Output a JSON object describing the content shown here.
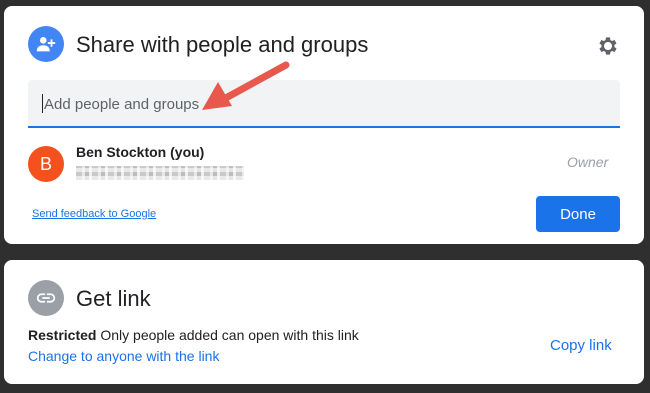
{
  "share": {
    "title": "Share with people and groups",
    "add_placeholder": "Add people and groups",
    "user": {
      "initial": "B",
      "name": "Ben Stockton (you)",
      "email": "████████████████",
      "role": "Owner"
    },
    "feedback_label": "Send feedback to Google",
    "done_label": "Done"
  },
  "link": {
    "title": "Get link",
    "restricted_label": "Restricted",
    "restricted_desc": "Only people added can open with this link",
    "change_label": "Change to anyone with the link",
    "copy_label": "Copy link"
  },
  "colors": {
    "accent": "#1a73e8",
    "share_icon_bg": "#4285f4",
    "user_avatar_bg": "#f4511e",
    "link_icon_bg": "#9aa0a6",
    "annotation_arrow": "#e8584c",
    "backdrop": "#2f2f2f"
  },
  "icons": {
    "share": "person-add-icon",
    "settings": "gear-icon",
    "link": "link-icon",
    "annotation": "arrow-icon"
  }
}
